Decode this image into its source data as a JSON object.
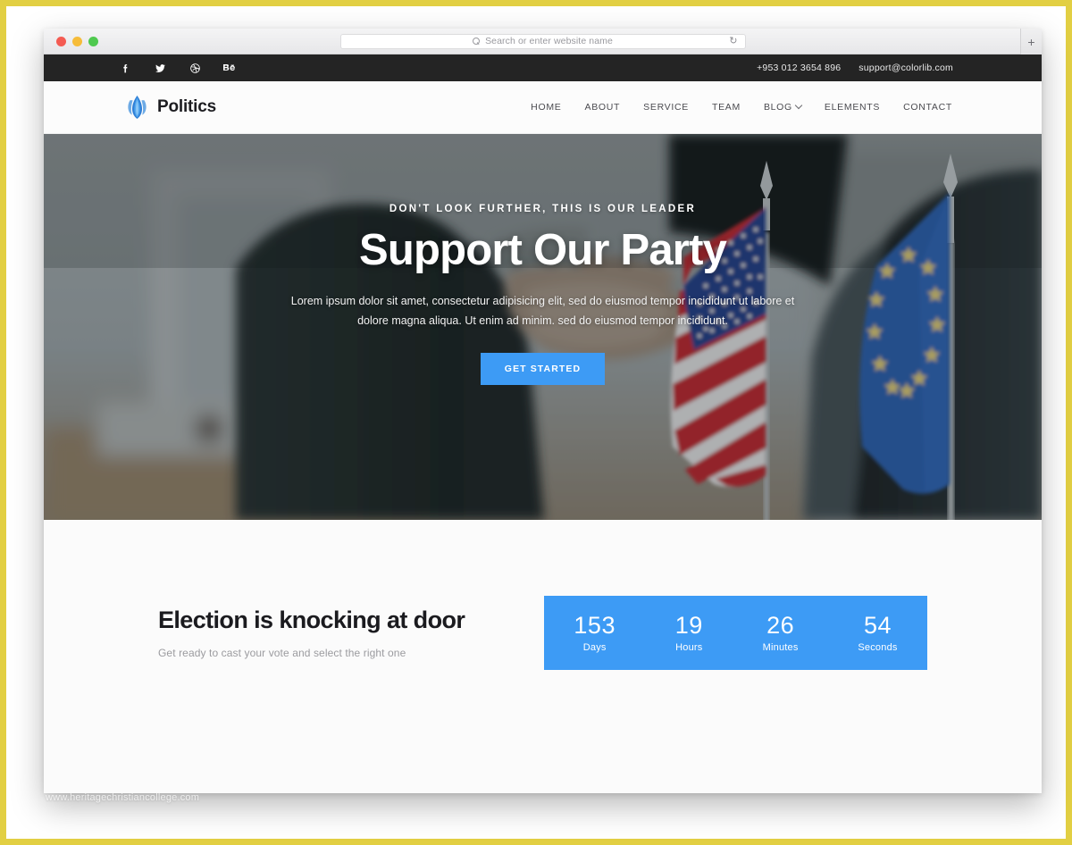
{
  "browser": {
    "address_placeholder": "Search or enter website name",
    "search_icon": "search-icon",
    "reload_icon": "↻",
    "new_tab_label": "+"
  },
  "topbar": {
    "social": [
      {
        "name": "facebook-icon",
        "glyph": "f"
      },
      {
        "name": "twitter-icon",
        "glyph": "t"
      },
      {
        "name": "dribbble-icon",
        "glyph": "d"
      },
      {
        "name": "behance-icon",
        "glyph": "Bē"
      }
    ],
    "phone": "+953 012 3654 896",
    "email": "support@colorlib.com"
  },
  "header": {
    "logo_text": "Politics",
    "nav": [
      {
        "label": "HOME",
        "has_dropdown": false
      },
      {
        "label": "ABOUT",
        "has_dropdown": false
      },
      {
        "label": "SERVICE",
        "has_dropdown": false
      },
      {
        "label": "TEAM",
        "has_dropdown": false
      },
      {
        "label": "BLOG",
        "has_dropdown": true
      },
      {
        "label": "ELEMENTS",
        "has_dropdown": false
      },
      {
        "label": "CONTACT",
        "has_dropdown": false
      }
    ]
  },
  "hero": {
    "kicker": "DON'T LOOK FURTHER, THIS IS OUR LEADER",
    "title": "Support Our Party",
    "subtitle": "Lorem ipsum dolor sit amet, consectetur adipisicing elit, sed do eiusmod tempor incididunt ut labore et dolore magna aliqua. Ut enim ad minim. sed do eiusmod tempor incididunt.",
    "cta_label": "GET STARTED"
  },
  "countdown_section": {
    "title": "Election is knocking at door",
    "subtitle": "Get ready to cast your vote and select the right one",
    "items": [
      {
        "value": "153",
        "label": "Days"
      },
      {
        "value": "19",
        "label": "Hours"
      },
      {
        "value": "26",
        "label": "Minutes"
      },
      {
        "value": "54",
        "label": "Seconds"
      }
    ]
  },
  "watermark": "www.heritagechristiancollege.com",
  "colors": {
    "accent": "#3d9bf5",
    "topbar_bg": "#242424",
    "frame": "#e2cf43",
    "heading": "#1b1b1f"
  }
}
